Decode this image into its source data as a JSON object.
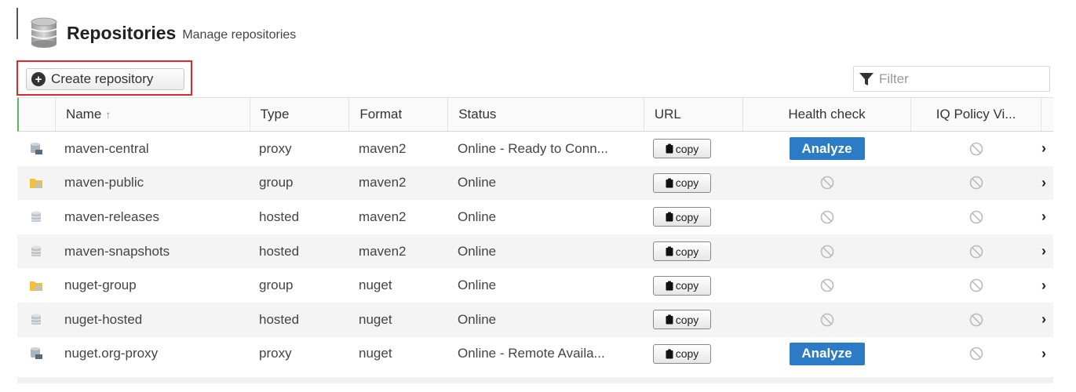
{
  "header": {
    "title": "Repositories",
    "subtitle": "Manage repositories",
    "icon": "database-icon"
  },
  "toolbar": {
    "create_label": "Create repository",
    "filter_placeholder": "Filter"
  },
  "columns": {
    "name": "Name",
    "type": "Type",
    "format": "Format",
    "status": "Status",
    "url": "URL",
    "health": "Health check",
    "iq": "IQ Policy Vi..."
  },
  "rows": [
    {
      "icon": "proxy-repo-icon",
      "name": "maven-central",
      "type": "proxy",
      "format": "maven2",
      "status": "Online - Ready to Conn...",
      "copy": "copy",
      "health": "Analyze"
    },
    {
      "icon": "group-repo-icon",
      "name": "maven-public",
      "type": "group",
      "format": "maven2",
      "status": "Online",
      "copy": "copy",
      "health": ""
    },
    {
      "icon": "hosted-repo-icon",
      "name": "maven-releases",
      "type": "hosted",
      "format": "maven2",
      "status": "Online",
      "copy": "copy",
      "health": ""
    },
    {
      "icon": "hosted-repo-icon",
      "name": "maven-snapshots",
      "type": "hosted",
      "format": "maven2",
      "status": "Online",
      "copy": "copy",
      "health": ""
    },
    {
      "icon": "group-repo-icon",
      "name": "nuget-group",
      "type": "group",
      "format": "nuget",
      "status": "Online",
      "copy": "copy",
      "health": ""
    },
    {
      "icon": "hosted-repo-icon",
      "name": "nuget-hosted",
      "type": "hosted",
      "format": "nuget",
      "status": "Online",
      "copy": "copy",
      "health": ""
    },
    {
      "icon": "proxy-repo-icon",
      "name": "nuget.org-proxy",
      "type": "proxy",
      "format": "nuget",
      "status": "Online - Remote Availa...",
      "copy": "copy",
      "health": "Analyze"
    }
  ],
  "colors": {
    "accent": "#2b7bc7",
    "highlight": "#e3262b"
  }
}
